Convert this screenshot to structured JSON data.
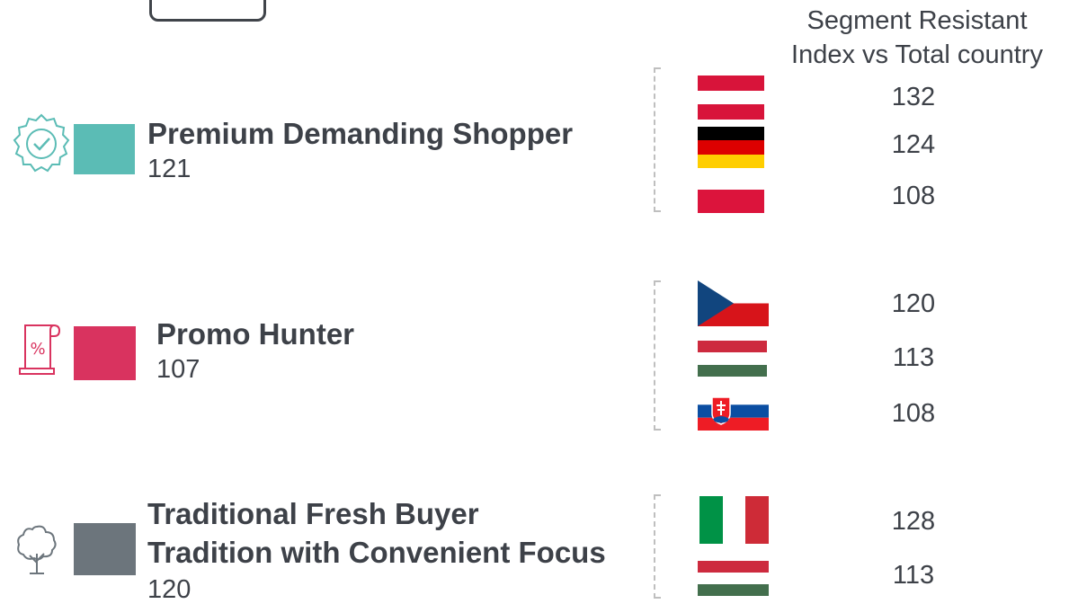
{
  "header": {
    "line1": "Segment Resistant",
    "line2": "Index vs Total country"
  },
  "colors": {
    "teal": "#5bbcb5",
    "pink": "#d9335f",
    "gray": "#6c757c"
  },
  "segments": [
    {
      "name": "Premium Demanding Shopper",
      "value": "121",
      "icon": "badge-check-icon",
      "swatch_color": "#5bbcb5",
      "countries": [
        {
          "flag": "austria-flag",
          "index": "132"
        },
        {
          "flag": "germany-flag",
          "index": "124"
        },
        {
          "flag": "poland-flag",
          "index": "108"
        }
      ]
    },
    {
      "name": "Promo Hunter",
      "value": "107",
      "icon": "percent-receipt-icon",
      "swatch_color": "#d9335f",
      "countries": [
        {
          "flag": "czech-flag",
          "index": "120"
        },
        {
          "flag": "hungary-flag",
          "index": "113"
        },
        {
          "flag": "slovakia-flag",
          "index": "108"
        }
      ]
    },
    {
      "name_line1": "Traditional Fresh Buyer",
      "name_line2": "Tradition with Convenient Focus",
      "value": "120",
      "icon": "tree-icon",
      "swatch_color": "#6c757c",
      "countries": [
        {
          "flag": "italy-flag",
          "index": "128"
        },
        {
          "flag": "hungary-flag",
          "index": "113"
        }
      ]
    }
  ]
}
